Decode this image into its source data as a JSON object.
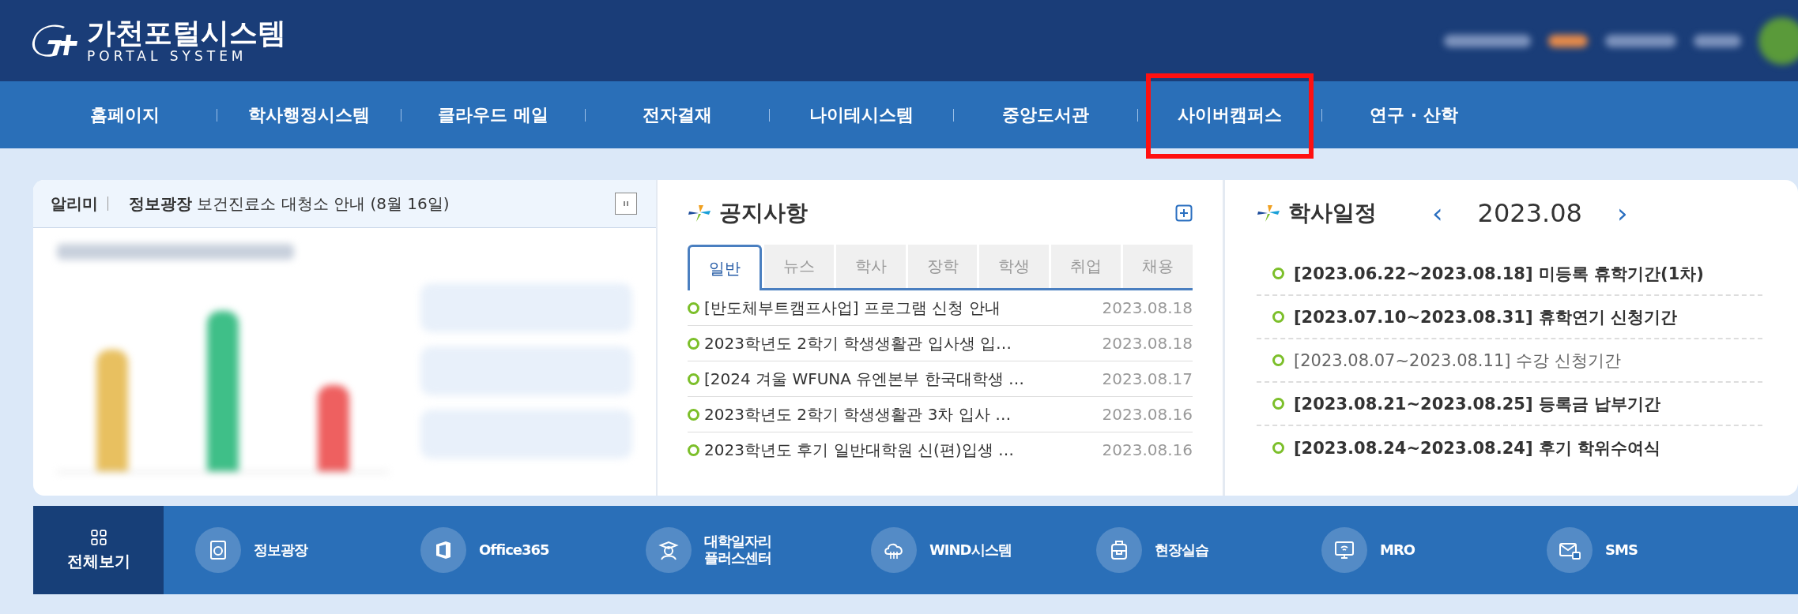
{
  "header": {
    "logo_title": "가천포털시스템",
    "logo_subtitle": "PORTAL SYSTEM"
  },
  "nav": [
    {
      "label": "홈페이지",
      "highlighted": false
    },
    {
      "label": "학사행정시스템",
      "highlighted": false
    },
    {
      "label": "클라우드 메일",
      "highlighted": false
    },
    {
      "label": "전자결재",
      "highlighted": false
    },
    {
      "label": "나이테시스템",
      "highlighted": false
    },
    {
      "label": "중앙도서관",
      "highlighted": false
    },
    {
      "label": "사이버캠퍼스",
      "highlighted": true
    },
    {
      "label": "연구 · 산학",
      "highlighted": false
    }
  ],
  "alert": {
    "label": "알리미",
    "message": "**정보광장** 보건진료소 대청소 안내 (8월 16일)"
  },
  "notices": {
    "title": "공지사항",
    "tabs": [
      {
        "label": "일반",
        "selected": true
      },
      {
        "label": "뉴스",
        "selected": false
      },
      {
        "label": "학사",
        "selected": false
      },
      {
        "label": "장학",
        "selected": false
      },
      {
        "label": "학생",
        "selected": false
      },
      {
        "label": "취업",
        "selected": false
      },
      {
        "label": "채용",
        "selected": false
      }
    ],
    "rows": [
      {
        "title": "[반도체부트캠프사업] 프로그램 신청 안내",
        "date": "2023.08.18"
      },
      {
        "title": "2023학년도 2학기 학생생활관 입사생 입…",
        "date": "2023.08.18"
      },
      {
        "title": "[2024 겨울 WFUNA 유엔본부 한국대학생 …",
        "date": "2023.08.17"
      },
      {
        "title": "2023학년도 2학기 학생생활관 3차 입사 …",
        "date": "2023.08.16"
      },
      {
        "title": "2023학년도 후기 일반대학원 신(편)입생 …",
        "date": "2023.08.16"
      }
    ]
  },
  "schedule": {
    "title": "학사일정",
    "prev": "‹",
    "month": "2023.08",
    "next": "›",
    "items": [
      {
        "text": "[2023.06.22~2023.08.18] 미등록 휴학기간(1차)",
        "emphasized": true
      },
      {
        "text": "[2023.07.10~2023.08.31] 휴학연기 신청기간",
        "emphasized": true
      },
      {
        "text": "[2023.08.07~2023.08.11] 수강 신청기간",
        "emphasized": false
      },
      {
        "text": "[2023.08.21~2023.08.25] 등록금 납부기간",
        "emphasized": true
      },
      {
        "text": "[2023.08.24~2023.08.24] 후기 학위수여식",
        "emphasized": true
      }
    ]
  },
  "quick_menu": [
    {
      "label": "전체보기",
      "selected": true
    },
    {
      "label": "정보광장",
      "selected": false
    },
    {
      "label": "Office365",
      "selected": false
    },
    {
      "label": "대학일자리\n플러스센터",
      "selected": false
    },
    {
      "label": "WIND시스템",
      "selected": false
    },
    {
      "label": "현장실습",
      "selected": false
    },
    {
      "label": "MRO",
      "selected": false
    },
    {
      "label": "SMS",
      "selected": false
    }
  ]
}
